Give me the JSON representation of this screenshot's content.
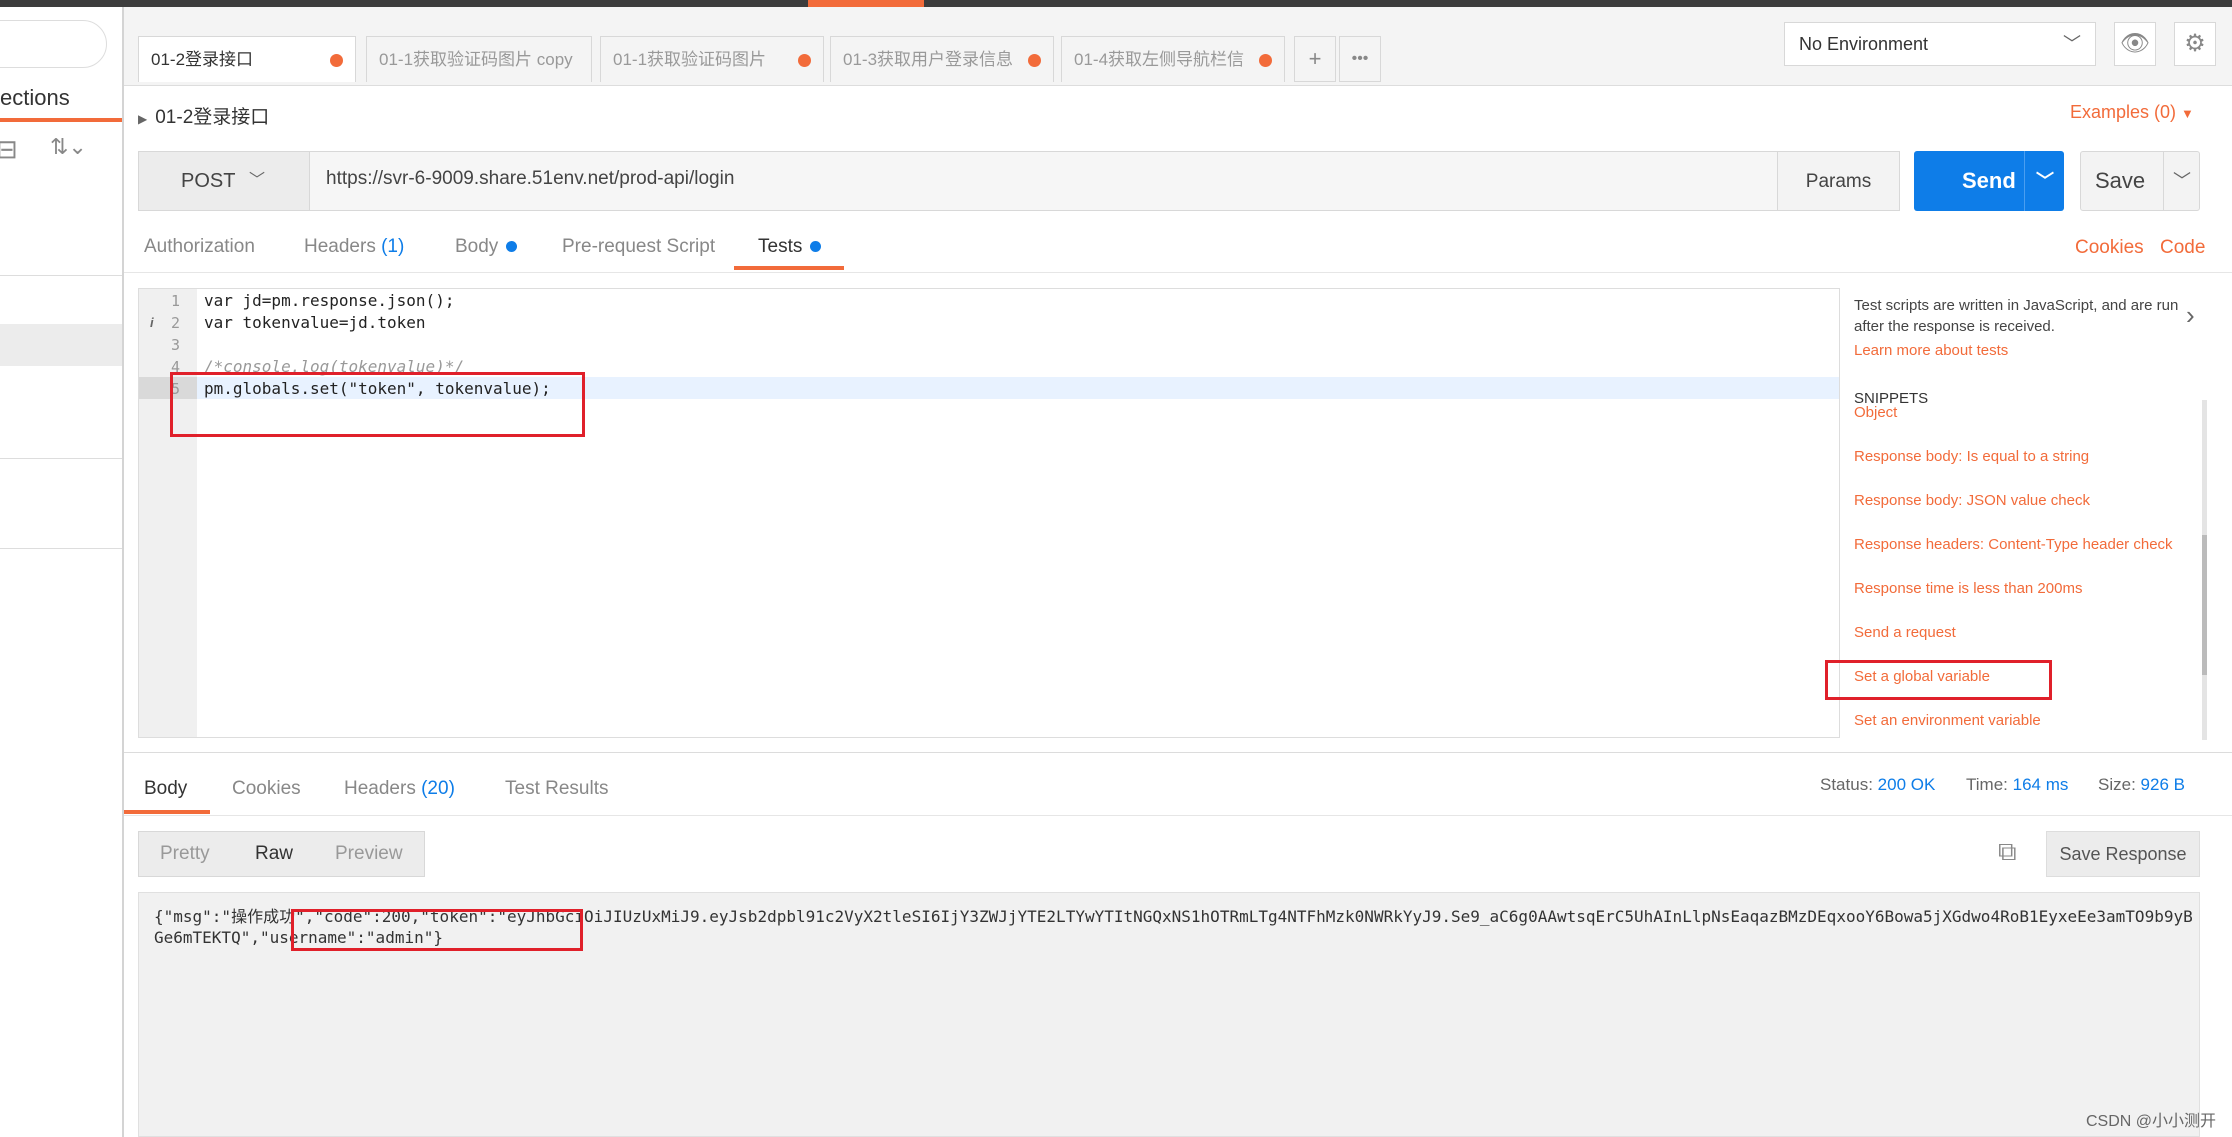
{
  "tabs": [
    {
      "label": "01-2登录接口",
      "active": true,
      "unsaved": true
    },
    {
      "label": "01-1获取验证码图片 copy",
      "active": false,
      "unsaved": false
    },
    {
      "label": "01-1获取验证码图片",
      "active": false,
      "unsaved": true
    },
    {
      "label": "01-3获取用户登录信息",
      "active": false,
      "unsaved": true
    },
    {
      "label": "01-4获取左侧导航栏信",
      "active": false,
      "unsaved": true
    }
  ],
  "tab_add": "+",
  "tab_more": "•••",
  "environment": {
    "selected": "No Environment",
    "chevron": "⌄"
  },
  "sidebar": {
    "title": "ections"
  },
  "request": {
    "name": "01-2登录接口",
    "examples_label": "Examples (0)",
    "method": "POST",
    "url": "https://svr-6-9009.share.51env.net/prod-api/login",
    "params_label": "Params",
    "send_label": "Send",
    "save_label": "Save"
  },
  "request_tabs": [
    {
      "label": "Authorization",
      "count": ""
    },
    {
      "label": "Headers",
      "count": "(1)"
    },
    {
      "label": "Body",
      "count": ""
    },
    {
      "label": "Pre-request Script",
      "count": ""
    },
    {
      "label": "Tests",
      "count": ""
    }
  ],
  "cookies_label": "Cookies",
  "code_label": "Code",
  "editor": {
    "line_numbers": [
      "1",
      "2",
      "3",
      "4",
      "5"
    ],
    "lines": [
      "var jd=pm.response.json();",
      "var tokenvalue=jd.token",
      "",
      "/*console.log(tokenvalue)*/",
      "pm.globals.set(\"token\", tokenvalue);"
    ]
  },
  "snippets_panel": {
    "description": "Test scripts are written in JavaScript, and are run after the response is received.",
    "learn_more": "Learn more about tests",
    "title": "SNIPPETS",
    "items": [
      "Object",
      "Response body: Is equal to a string",
      "Response body: JSON value check",
      "Response headers: Content-Type header check",
      "Response time is less than 200ms",
      "Send a request",
      "Set a global variable",
      "Set an environment variable"
    ]
  },
  "response": {
    "tabs": [
      {
        "label": "Body",
        "count": ""
      },
      {
        "label": "Cookies",
        "count": ""
      },
      {
        "label": "Headers",
        "count": "(20)"
      },
      {
        "label": "Test Results",
        "count": ""
      }
    ],
    "status_label": "Status:",
    "status_value": "200 OK",
    "time_label": "Time:",
    "time_value": "164 ms",
    "size_label": "Size:",
    "size_value": "926 B",
    "formats": [
      "Pretty",
      "Raw",
      "Preview"
    ],
    "selected_format": "Raw",
    "save_response_label": "Save Response",
    "body_text": "{\"msg\":\"操作成功\",\"code\":200,\"token\":\"eyJhbGciOiJIUzUxMiJ9.eyJsb2dpbl91c2VyX2tleSI6IjY3ZWJjYTE2LTYwYTItNGQxNS1hOTRmLTg4NTFhMzk0NWRkYyJ9.Se9_aC6g0AAwtsqErC5UhAInLlpNsEaqazBMzDEqxooY6Bowa5jXGdwo4RoB1EyxeEe3amTO9b9yBGe6mTEKTQ\",\"username\":\"admin\"}"
  },
  "watermark": "CSDN @小小测开",
  "colors": {
    "accent": "#f26b3a",
    "primary": "#0e7de8",
    "highlight_box": "#e0202a"
  }
}
